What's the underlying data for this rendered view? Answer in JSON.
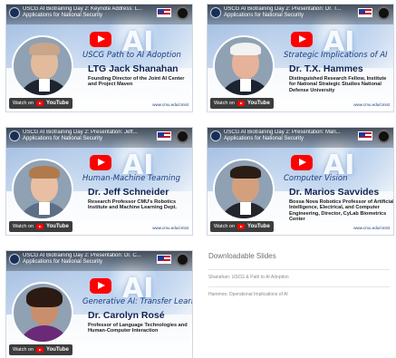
{
  "videos": [
    {
      "video_title": "USCG AI Biotraining Day 2: Keynote Address: L...",
      "video_subtitle": "Applications for National Security",
      "talk_title": "USCG Path to AI Adoption",
      "speaker_name": "LTG Jack Shanahan",
      "speaker_role": "Founding Director of the Joint AI Center and Project Maven",
      "watch_label": "Watch on",
      "youtube_label": "YouTube",
      "url_text": "www.cmu.edu/cmist",
      "bg_glyph": "AI",
      "skin": "#e2bb9c",
      "hair": "#c9a58a",
      "suit": "#1d2430"
    },
    {
      "video_title": "USCG AI Biotraining Day 2: Presentation: Dr. T...",
      "video_subtitle": "Applications for National Security",
      "talk_title": "Strategic Implications of AI",
      "speaker_name": "Dr. T.X. Hammes",
      "speaker_role": "Distinguished Research Fellow, Institute for National Strategic Studies National Defense University",
      "watch_label": "Watch on",
      "youtube_label": "YouTube",
      "url_text": "www.cmu.edu/cmist",
      "bg_glyph": "AI",
      "skin": "#e6b29a",
      "hair": "#f2f2f2",
      "suit": "#1b2230"
    },
    {
      "video_title": "USCG AI Biotraining Day 2: Presentation: Jeff...",
      "video_subtitle": "Applications for National Security",
      "talk_title": "Human-Machine Teaming",
      "speaker_name": "Dr. Jeff Schneider",
      "speaker_role": "Research Professor CMU's Robotics Institute and Machine Learning Dept.",
      "watch_label": "Watch on",
      "youtube_label": "YouTube",
      "url_text": "www.cmu.edu/cmist",
      "bg_glyph": "AI",
      "skin": "#e8bfa2",
      "hair": "#b07a4c",
      "suit": "#5c6f86"
    },
    {
      "video_title": "USCG AI Biotraining Day 2: Presentation: Mari...",
      "video_subtitle": "Applications for National Security",
      "talk_title": "Computer Vision",
      "speaker_name": "Dr. Marios Savvides",
      "speaker_role": "Bossa Nova Robotics Professor of Artificial Intelligence, Electrical, and Computer Engineering, Director, CyLab Biometrics Center",
      "watch_label": "Watch on",
      "youtube_label": "YouTube",
      "url_text": "www.cmu.edu/cmist",
      "bg_glyph": "AI",
      "skin": "#d3a07e",
      "hair": "#2a1d16",
      "suit": "#23252b"
    },
    {
      "video_title": "USCG AI Biotraining Day 2: Presentation: Dr. C...",
      "video_subtitle": "Applications for National Security",
      "talk_title": "Generative AI: Transfer Learning",
      "speaker_name": "Dr. Carolyn Rosé",
      "speaker_role": "Professor of Language Technologies and Human-Computer Interaction",
      "watch_label": "Watch on",
      "youtube_label": "YouTube",
      "url_text": "",
      "bg_glyph": "AI",
      "skin": "#c98f6c",
      "hair": "#2b1a14",
      "suit": "#6a2a78"
    }
  ],
  "downloads": {
    "heading": "Downloadable Slides",
    "items": [
      "Shanahan: USCG & Path to AI Adoption",
      "Hammes: Operational Implications of AI"
    ]
  }
}
